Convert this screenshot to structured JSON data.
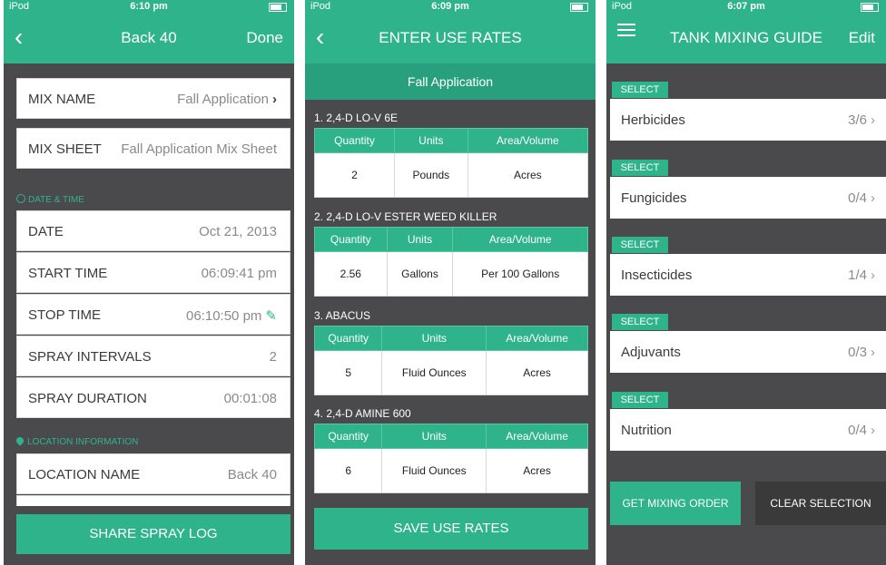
{
  "screen1": {
    "status": {
      "carrier": "iPod",
      "time": "6:10 pm"
    },
    "nav": {
      "back": "‹",
      "title": "Back 40",
      "done": "Done"
    },
    "mix_name": {
      "label": "MIX NAME",
      "value": "Fall Application",
      "chevron": "›"
    },
    "mix_sheet": {
      "label": "MIX SHEET",
      "value": "Fall Application Mix Sheet"
    },
    "date_time_header": "DATE & TIME",
    "date": {
      "label": "DATE",
      "value": "Oct 21, 2013"
    },
    "start_time": {
      "label": "START TIME",
      "value": "06:09:41 pm"
    },
    "stop_time": {
      "label": "STOP TIME",
      "value": "06:10:50 pm"
    },
    "spray_intervals": {
      "label": "SPRAY INTERVALS",
      "value": "2"
    },
    "spray_duration": {
      "label": "SPRAY DURATION",
      "value": "00:01:08"
    },
    "location_header": "LOCATION INFORMATION",
    "location_name": {
      "label": "LOCATION NAME",
      "value": "Back 40"
    },
    "share_button": "SHARE SPRAY LOG"
  },
  "screen2": {
    "status": {
      "carrier": "iPod",
      "time": "6:09 pm"
    },
    "nav": {
      "back": "‹",
      "title": "ENTER USE RATES"
    },
    "subheader": "Fall Application",
    "headers": [
      "Quantity",
      "Units",
      "Area/Volume"
    ],
    "products": [
      {
        "name": "1.  2,4-D LO-V 6E",
        "quantity": "2",
        "units": "Pounds",
        "area": "Acres"
      },
      {
        "name": "2.  2,4-D LO-V ESTER WEED KILLER",
        "quantity": "2.56",
        "units": "Gallons",
        "area": "Per 100 Gallons"
      },
      {
        "name": "3.  ABACUS",
        "quantity": "5",
        "units": "Fluid Ounces",
        "area": "Acres"
      },
      {
        "name": "4.  2,4-D AMINE 600",
        "quantity": "6",
        "units": "Fluid Ounces",
        "area": "Acres"
      }
    ],
    "save_button": "SAVE USE RATES"
  },
  "screen3": {
    "status": {
      "carrier": "iPod",
      "time": "6:07 pm"
    },
    "nav": {
      "title": "TANK MIXING GUIDE",
      "edit": "Edit"
    },
    "select_label": "SELECT",
    "categories": [
      {
        "label": "Herbicides",
        "count": "3/6"
      },
      {
        "label": "Fungicides",
        "count": "0/4"
      },
      {
        "label": "Insecticides",
        "count": "1/4"
      },
      {
        "label": "Adjuvants",
        "count": "0/3"
      },
      {
        "label": "Nutrition",
        "count": "0/4"
      }
    ],
    "chevron": "›",
    "get_mixing_order": "GET MIXING ORDER",
    "clear_selection": "CLEAR SELECTION"
  },
  "colors": {
    "accent": "#2fb38b",
    "background": "#4a4a4c",
    "clear_button": "#3a3a3a"
  }
}
